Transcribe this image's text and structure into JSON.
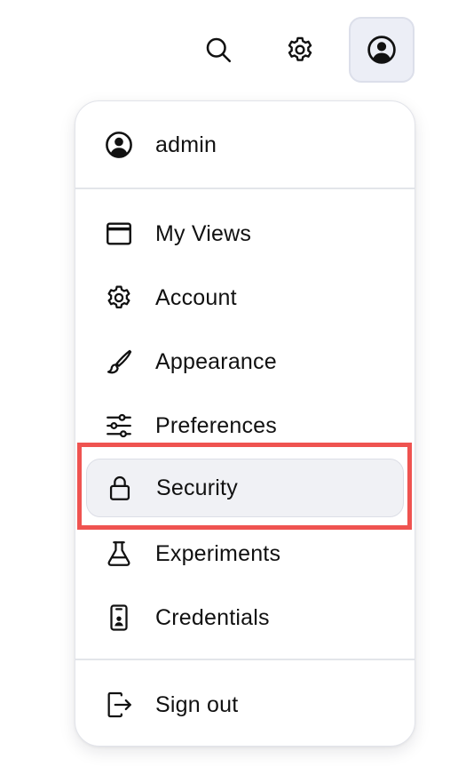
{
  "topbar": {
    "search_icon": "search-icon",
    "settings_icon": "gear-icon",
    "user_icon": "user-circle-icon"
  },
  "menu": {
    "user": {
      "label": "admin",
      "icon": "user-circle-icon"
    },
    "items": [
      {
        "label": "My Views",
        "icon": "window-icon"
      },
      {
        "label": "Account",
        "icon": "gear-icon"
      },
      {
        "label": "Appearance",
        "icon": "brush-icon"
      },
      {
        "label": "Preferences",
        "icon": "sliders-icon"
      },
      {
        "label": "Security",
        "icon": "lock-icon",
        "active": true
      },
      {
        "label": "Experiments",
        "icon": "flask-icon"
      },
      {
        "label": "Credentials",
        "icon": "id-badge-icon"
      }
    ],
    "signout": {
      "label": "Sign out",
      "icon": "sign-out-icon"
    }
  },
  "colors": {
    "highlight_border": "#ef5350",
    "active_item_bg": "#f0f1f5",
    "user_button_bg": "#eceef6",
    "divider": "#e3e5ea"
  }
}
